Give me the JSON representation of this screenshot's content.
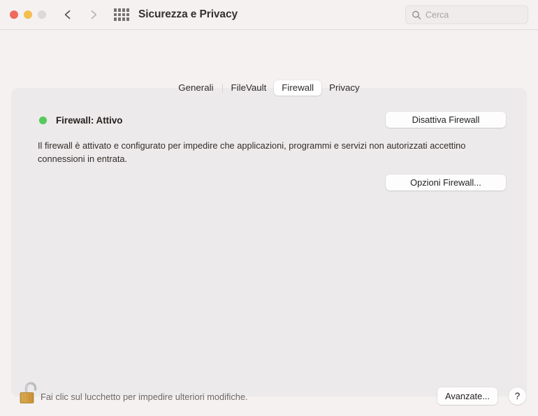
{
  "window": {
    "title": "Sicurezza e Privacy",
    "traffic_lights": [
      {
        "name": "close",
        "color": "#ee6a5f"
      },
      {
        "name": "minimize",
        "color": "#f5bd4f"
      },
      {
        "name": "zoom",
        "color": "#dcd9d8"
      }
    ],
    "nav": {
      "back_icon": "chevron-left-icon",
      "forward_icon": "chevron-right-icon",
      "grid_icon": "grid-view-icon"
    }
  },
  "search": {
    "icon": "search-icon",
    "placeholder": "Cerca",
    "value": ""
  },
  "tabs": [
    {
      "label": "Generali",
      "selected": false
    },
    {
      "label": "FileVault",
      "selected": false
    },
    {
      "label": "Firewall",
      "selected": true
    },
    {
      "label": "Privacy",
      "selected": false
    }
  ],
  "firewall": {
    "status_icon": "status-dot-icon",
    "status_color": "#55cb5a",
    "status_label": "Firewall: Attivo",
    "disable_button": "Disattiva Firewall",
    "description": "Il firewall è attivato e configurato per impedire che applicazioni, programmi e servizi non autorizzati accettino connessioni in entrata.",
    "options_button": "Opzioni Firewall..."
  },
  "footer": {
    "lock_icon": "unlocked-padlock-icon",
    "lock_message": "Fai clic sul lucchetto per impedire ulteriori modifiche.",
    "advanced_button": "Avanzate...",
    "help_button": "?"
  },
  "colors": {
    "window_background": "#f4f1f0",
    "panel_background": "#eceaea",
    "accent_green": "#55cb5a",
    "lock_gold": "#d9a441"
  }
}
